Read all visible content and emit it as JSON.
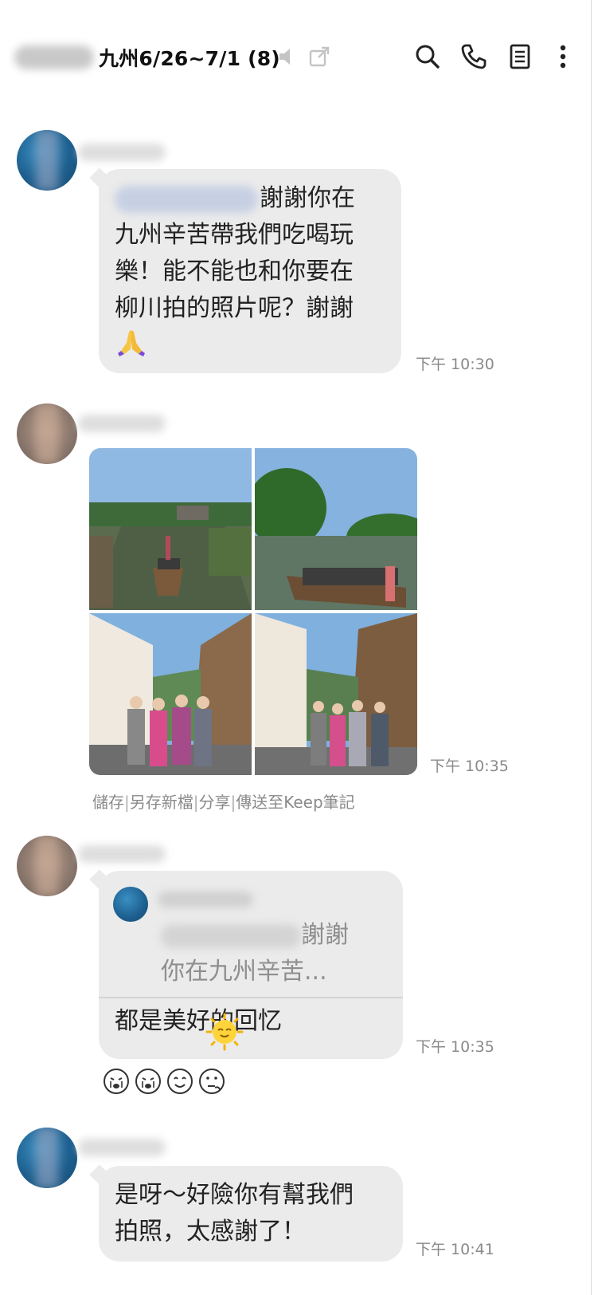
{
  "header": {
    "chat_title": "九州6/26~7/1 (8)",
    "icons": [
      "speaker-muted-icon",
      "popout-icon",
      "search-icon",
      "phone-icon",
      "notes-icon",
      "more-vertical-icon"
    ]
  },
  "messages": [
    {
      "lines": [
        "謝謝你在",
        "九州辛苦帶我們吃喝玩",
        "樂！能不能也和你要在",
        "柳川拍的照片呢？謝謝"
      ],
      "emoji": "praying-hands-icon",
      "time": "下午 10:30"
    },
    {
      "photos": [
        "canal-boat-photo",
        "canal-trees-photo",
        "group-street-photo-1",
        "group-street-photo-2"
      ],
      "time": "下午 10:35",
      "actions": [
        "儲存",
        "另存新檔",
        "分享",
        "傳送至Keep筆記"
      ]
    },
    {
      "reply_quote_lines": [
        "謝謝",
        "你在九州辛苦..."
      ],
      "text": "都是美好的回忆",
      "emoji": "smiling-sun-icon",
      "time": "下午 10:35",
      "reactions": [
        "crying-face-icon",
        "crying-face-icon",
        "smiling-face-icon",
        "thinking-face-icon"
      ]
    },
    {
      "lines": [
        "是呀～好險你有幫我們",
        "拍照，太感謝了！"
      ],
      "time": "下午 10:41"
    }
  ],
  "colors": {
    "bubble": "#ebebeb",
    "timestamp": "#8a8a8a",
    "title": "#111111"
  }
}
